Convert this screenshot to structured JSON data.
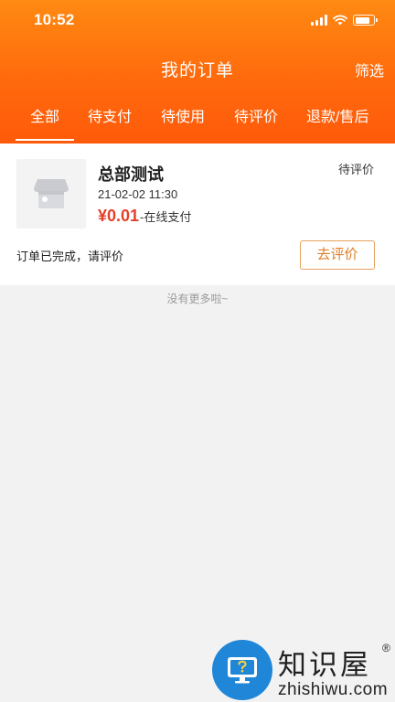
{
  "status_bar": {
    "time": "10:52",
    "battery_level": 0.8
  },
  "navbar": {
    "title": "我的订单",
    "filter_label": "筛选"
  },
  "tabs": [
    {
      "label": "全部",
      "active": true
    },
    {
      "label": "待支付"
    },
    {
      "label": "待使用"
    },
    {
      "label": "待评价"
    },
    {
      "label": "退款/售后"
    }
  ],
  "order": {
    "store_name": "总部测试",
    "status": "待评价",
    "time": "21-02-02 11:30",
    "price": "¥0.01",
    "pay_method": "-在线支付",
    "message": "订单已完成，请评价",
    "action_label": "去评价"
  },
  "list_footer": "没有更多啦~",
  "watermark": {
    "brand": "知识屋",
    "registered": "®",
    "domain": "zhishiwu.com"
  },
  "colors": {
    "header_gradient_top": "#ff8a12",
    "header_gradient_bottom": "#ff5a0a",
    "price": "#e53e2a",
    "button_border": "#e5a15a",
    "button_text": "#e0802a",
    "background": "#f2f2f2"
  }
}
